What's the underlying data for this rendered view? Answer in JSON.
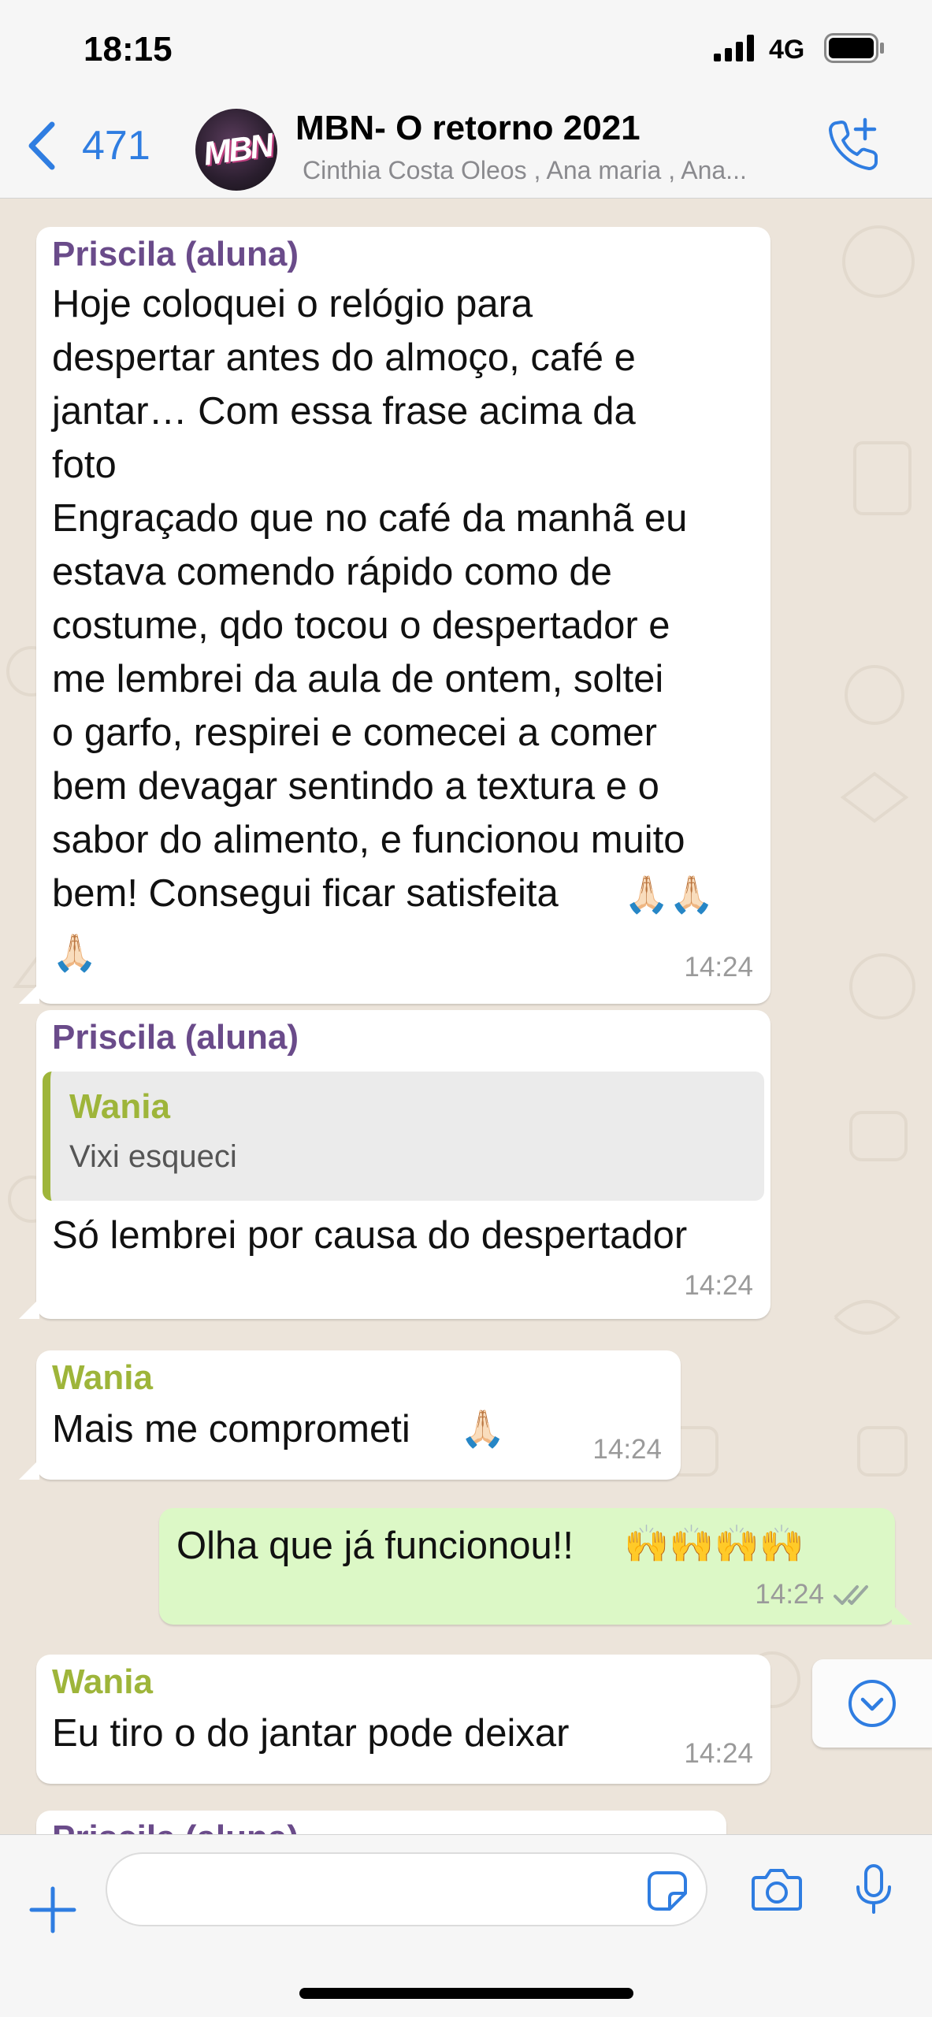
{
  "status_bar": {
    "time": "18:15",
    "network": "4G",
    "icons": [
      "signal-icon",
      "battery-icon"
    ]
  },
  "header": {
    "back_count": "471",
    "avatar_text": "MBN",
    "group_name": "MBN- O retorno 2021",
    "members": "Cinthia Costa Oleos , Ana maria , Ana...",
    "icons": [
      "chevron-left-icon",
      "add-call-icon"
    ]
  },
  "messages": [
    {
      "sender": "Priscila (aluna)",
      "text": "Hoje coloquei o relógio para\ndespertar antes do almoço, café e\njantar… Com essa frase acima da\nfoto\nEngraçado que no café da manhã eu\nestava comendo rápido como de\ncostume, qdo tocou o despertador e\nme lembrei da aula de ontem, soltei\no garfo, respirei e comecei a comer\nbem devagar sentindo a textura e o\nsabor do alimento, e funcionou muito\nbem! Consegui ficar satisfeita",
      "emoji_inline": "🙏🏻🙏🏻",
      "emoji_line": "🙏🏻",
      "time": "14:24"
    },
    {
      "sender": "Priscila (aluna)",
      "quote": {
        "sender": "Wania",
        "text": "Vixi esqueci"
      },
      "text": "Só lembrei por causa do despertador",
      "time": "14:24"
    },
    {
      "sender": "Wania",
      "text": "Mais me comprometi",
      "emoji": "🙏🏻",
      "time": "14:24"
    },
    {
      "text": "Olha que já funcionou!!",
      "emoji": "🙌🙌🙌🙌",
      "time": "14:24",
      "status_icon": "double-check-icon"
    },
    {
      "sender": "Wania",
      "text": "Eu tiro o do jantar pode deixar",
      "time": "14:24"
    },
    {
      "sender": "Priscila (aluna)"
    }
  ],
  "input_bar": {
    "placeholder": "",
    "icons": [
      "plus-icon",
      "sticker-icon",
      "camera-icon",
      "microphone-icon"
    ]
  },
  "colors": {
    "accent": "#2f7de1",
    "incoming_bubble": "#ffffff",
    "outgoing_bubble": "#dcf8c6",
    "priscila_name": "#6a4b8a",
    "wania_name": "#9eb53a",
    "chat_background": "#ece4da"
  }
}
